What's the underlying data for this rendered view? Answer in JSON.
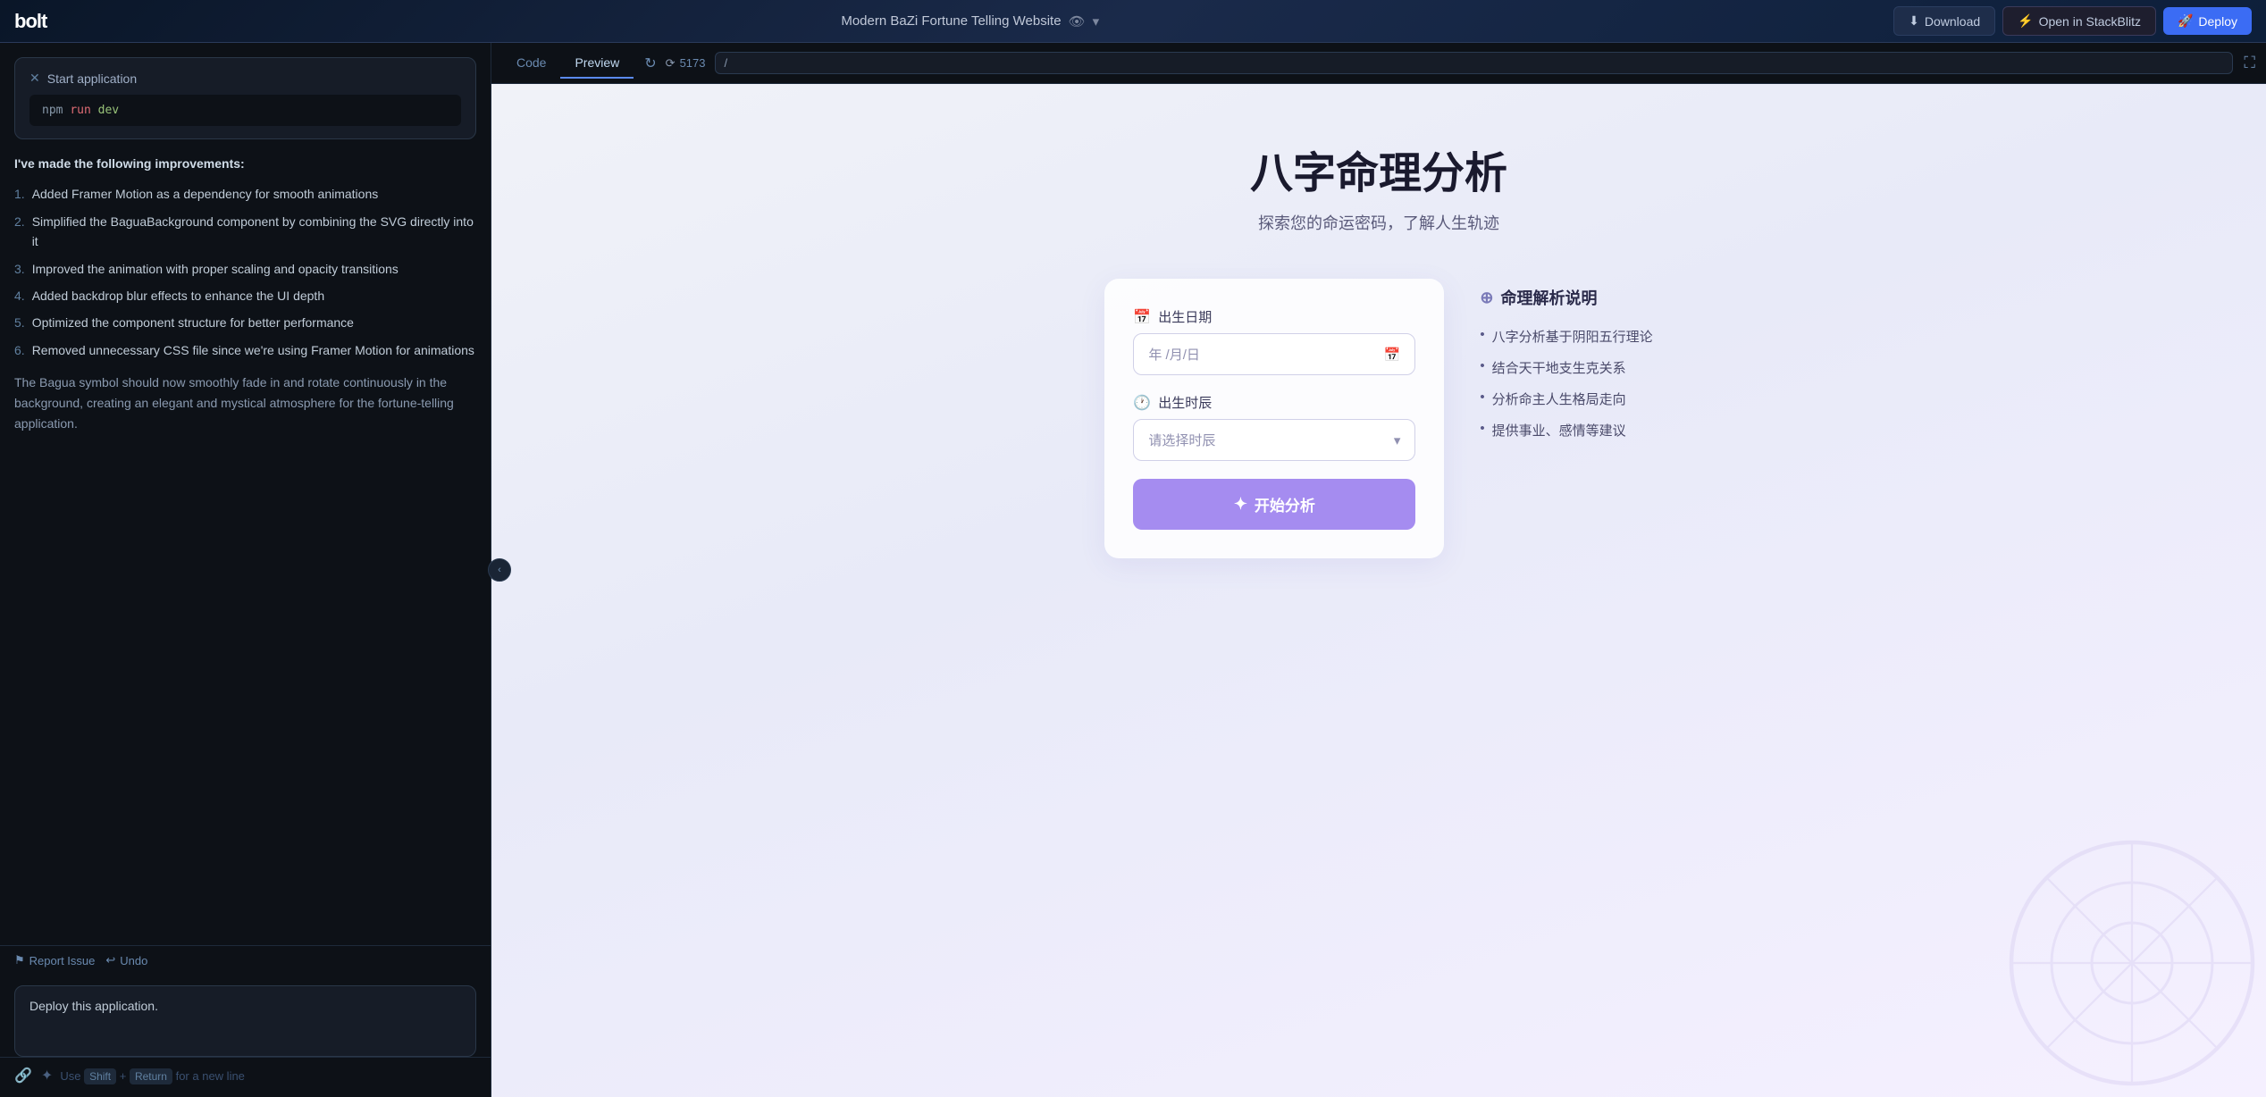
{
  "topbar": {
    "logo": "bolt",
    "project_title": "Modern BaZi Fortune Telling Website",
    "download_label": "Download",
    "stackblitz_label": "Open in StackBlitz",
    "deploy_label": "Deploy"
  },
  "left_panel": {
    "start_app": {
      "title": "Start application",
      "command": "npm run dev"
    },
    "improvements": {
      "intro": "I've made the following improvements:",
      "items": [
        "Added Framer Motion as a dependency for smooth animations",
        "Simplified the BaguaBackground component by combining the SVG directly into it",
        "Improved the animation with proper scaling and opacity transitions",
        "Added backdrop blur effects to enhance the UI depth",
        "Optimized the component structure for better performance",
        "Removed unnecessary CSS file since we're using Framer Motion for animations"
      ],
      "description": "The Bagua symbol should now smoothly fade in and rotate continuously in the background, creating an elegant and mystical atmosphere for the fortune-telling application."
    },
    "actions": {
      "report_issue": "Report Issue",
      "undo": "Undo"
    },
    "deploy_box": {
      "text": "Deploy this application."
    },
    "input": {
      "hint_use": "Use",
      "hint_shift": "Shift",
      "hint_plus": "+",
      "hint_return": "Return",
      "hint_for": "for a new line"
    }
  },
  "preview": {
    "tabs": [
      {
        "label": "Code",
        "active": false
      },
      {
        "label": "Preview",
        "active": true
      }
    ],
    "token_count": "5173",
    "url": "/",
    "fortune_site": {
      "title": "八字命理分析",
      "subtitle": "探索您的命运密码，了解人生轨迹",
      "form": {
        "date_label": "出生日期",
        "date_placeholder": "年 /月/日",
        "time_label": "出生时辰",
        "time_placeholder": "请选择时辰",
        "analyze_btn": "开始分析"
      },
      "info": {
        "title": "命理解析说明",
        "items": [
          "八字分析基于阴阳五行理论",
          "结合天干地支生克关系",
          "分析命主人生格局走向",
          "提供事业、感情等建议"
        ]
      }
    }
  }
}
